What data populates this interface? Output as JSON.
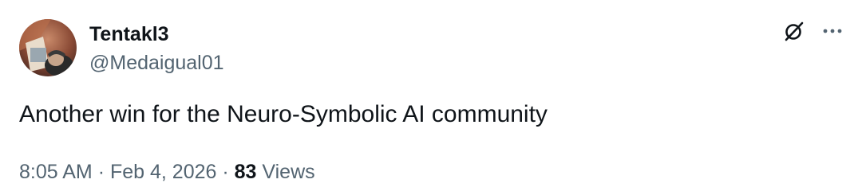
{
  "author": {
    "display_name": "Tentakl3",
    "handle": "@Medaigual01",
    "avatar_icon": "avatar-photo"
  },
  "actions": {
    "grok_icon": "grok-icon",
    "more_icon": "more-options-icon"
  },
  "post": {
    "text": "Another win for the Neuro-Symbolic AI community"
  },
  "meta": {
    "time": "8:05 AM",
    "separator": "·",
    "date": "Feb 4, 2026",
    "views_count": "83",
    "views_label": "Views"
  },
  "colors": {
    "primary_text": "#0f1419",
    "secondary_text": "#536471",
    "background": "#ffffff"
  }
}
